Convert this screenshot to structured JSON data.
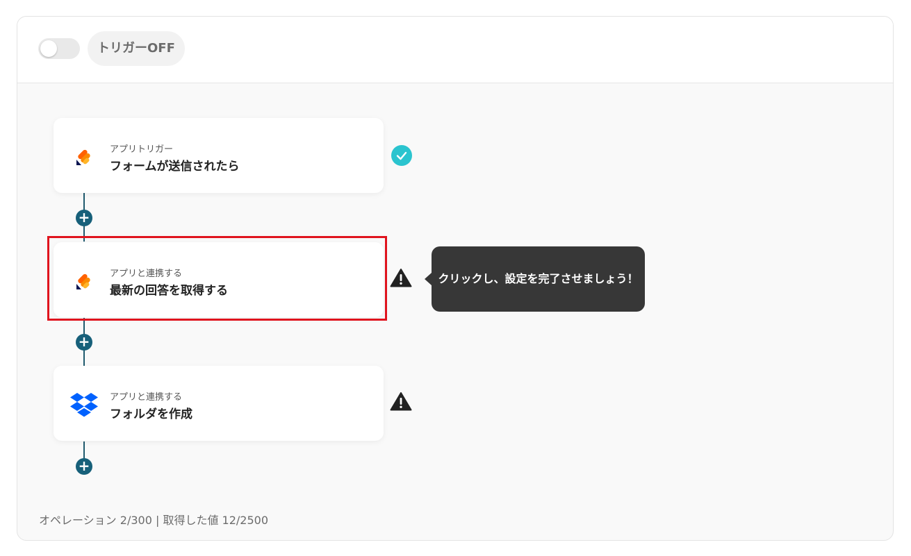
{
  "header": {
    "toggle_state": "off",
    "trigger_label": "トリガーOFF"
  },
  "steps": [
    {
      "subtitle": "アプリトリガー",
      "title": "フォームが送信されたら",
      "app_icon": "form-app-icon",
      "status": "complete"
    },
    {
      "subtitle": "アプリと連携する",
      "title": "最新の回答を取得する",
      "app_icon": "form-app-icon",
      "status": "warning",
      "highlighted": true
    },
    {
      "subtitle": "アプリと連携する",
      "title": "フォルダを作成",
      "app_icon": "dropbox-icon",
      "status": "warning"
    }
  ],
  "tooltip": {
    "text": "クリックし、設定を完了させましょう！"
  },
  "add_step_symbol": "+",
  "footer": {
    "text": "オペレーション 2/300 | 取得した値 12/2500"
  },
  "colors": {
    "accent": "#17607a",
    "check": "#2bc4cf",
    "highlight": "#e0141e",
    "tooltip_bg": "#373737",
    "dropbox": "#0061fe"
  }
}
